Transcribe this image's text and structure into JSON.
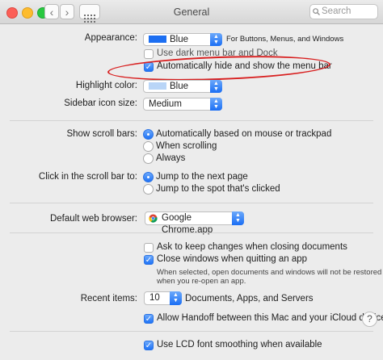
{
  "window": {
    "title": "General",
    "search_placeholder": "Search",
    "back": "‹",
    "forward": "›"
  },
  "traffic_colors": {
    "close": "#fc5f57",
    "minimize": "#fdbc2e",
    "zoom": "#28c840"
  },
  "appearance": {
    "label": "Appearance:",
    "value": "Blue",
    "note": "For Buttons, Menus, and Windows",
    "swatch": "#1d6ff2"
  },
  "dark_menu": {
    "label": "Use dark menu bar and Dock",
    "checked": false
  },
  "autohide": {
    "label": "Automatically hide and show the menu bar",
    "checked": true
  },
  "highlight": {
    "label": "Highlight color:",
    "value": "Blue",
    "swatch": "#b9d5f7"
  },
  "sidebar_size": {
    "label": "Sidebar icon size:",
    "value": "Medium"
  },
  "scroll_bars": {
    "label": "Show scroll bars:",
    "options": [
      "Automatically based on mouse or trackpad",
      "When scrolling",
      "Always"
    ],
    "selected": 0
  },
  "scroll_click": {
    "label": "Click in the scroll bar to:",
    "options": [
      "Jump to the next page",
      "Jump to the spot that's clicked"
    ],
    "selected": 0
  },
  "browser": {
    "label": "Default web browser:",
    "value": "Google Chrome.app"
  },
  "ask_keep": {
    "label": "Ask to keep changes when closing documents",
    "checked": false
  },
  "close_windows": {
    "label": "Close windows when quitting an app",
    "checked": true,
    "note1": "When selected, open documents and windows will not be restored",
    "note2": "when you re-open an app."
  },
  "recent": {
    "label": "Recent items:",
    "value": "10",
    "suffix": "Documents, Apps, and Servers"
  },
  "handoff": {
    "label": "Allow Handoff between this Mac and your iCloud devices",
    "checked": true
  },
  "help": "?",
  "lcd": {
    "label": "Use LCD font smoothing when available",
    "checked": true
  }
}
